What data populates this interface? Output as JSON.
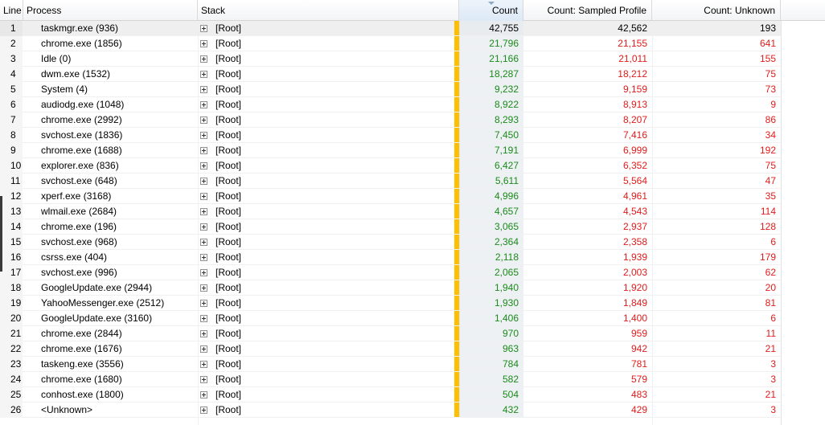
{
  "columns": {
    "line": "Line",
    "process": "Process",
    "stack": "Stack",
    "count": "Count",
    "sampled": "Count: Sampled Profile",
    "unknown": "Count: Unknown"
  },
  "colors": {
    "bar": "#ffbf00",
    "positive": "#1b8a1b",
    "negative": "#e01b1b"
  },
  "rows": [
    {
      "line": "1",
      "process": "taskmgr.exe (936)",
      "stack": "[Root]",
      "count": "42,755",
      "sampled": "42,562",
      "unknown": "193"
    },
    {
      "line": "2",
      "process": "chrome.exe (1856)",
      "stack": "[Root]",
      "count": "21,796",
      "sampled": "21,155",
      "unknown": "641"
    },
    {
      "line": "3",
      "process": "Idle (0)",
      "stack": "[Root]",
      "count": "21,166",
      "sampled": "21,011",
      "unknown": "155"
    },
    {
      "line": "4",
      "process": "dwm.exe (1532)",
      "stack": "[Root]",
      "count": "18,287",
      "sampled": "18,212",
      "unknown": "75"
    },
    {
      "line": "5",
      "process": "System (4)",
      "stack": "[Root]",
      "count": "9,232",
      "sampled": "9,159",
      "unknown": "73"
    },
    {
      "line": "6",
      "process": "audiodg.exe (1048)",
      "stack": "[Root]",
      "count": "8,922",
      "sampled": "8,913",
      "unknown": "9"
    },
    {
      "line": "7",
      "process": "chrome.exe (2992)",
      "stack": "[Root]",
      "count": "8,293",
      "sampled": "8,207",
      "unknown": "86"
    },
    {
      "line": "8",
      "process": "svchost.exe (1836)",
      "stack": "[Root]",
      "count": "7,450",
      "sampled": "7,416",
      "unknown": "34"
    },
    {
      "line": "9",
      "process": "chrome.exe (1688)",
      "stack": "[Root]",
      "count": "7,191",
      "sampled": "6,999",
      "unknown": "192"
    },
    {
      "line": "10",
      "process": "explorer.exe (836)",
      "stack": "[Root]",
      "count": "6,427",
      "sampled": "6,352",
      "unknown": "75"
    },
    {
      "line": "11",
      "process": "svchost.exe (648)",
      "stack": "[Root]",
      "count": "5,611",
      "sampled": "5,564",
      "unknown": "47"
    },
    {
      "line": "12",
      "process": "xperf.exe (3168)",
      "stack": "[Root]",
      "count": "4,996",
      "sampled": "4,961",
      "unknown": "35"
    },
    {
      "line": "13",
      "process": "wlmail.exe (2684)",
      "stack": "[Root]",
      "count": "4,657",
      "sampled": "4,543",
      "unknown": "114"
    },
    {
      "line": "14",
      "process": "chrome.exe (196)",
      "stack": "[Root]",
      "count": "3,065",
      "sampled": "2,937",
      "unknown": "128"
    },
    {
      "line": "15",
      "process": "svchost.exe (968)",
      "stack": "[Root]",
      "count": "2,364",
      "sampled": "2,358",
      "unknown": "6"
    },
    {
      "line": "16",
      "process": "csrss.exe (404)",
      "stack": "[Root]",
      "count": "2,118",
      "sampled": "1,939",
      "unknown": "179"
    },
    {
      "line": "17",
      "process": "svchost.exe (996)",
      "stack": "[Root]",
      "count": "2,065",
      "sampled": "2,003",
      "unknown": "62"
    },
    {
      "line": "18",
      "process": "GoogleUpdate.exe (2944)",
      "stack": "[Root]",
      "count": "1,940",
      "sampled": "1,920",
      "unknown": "20"
    },
    {
      "line": "19",
      "process": "YahooMessenger.exe (2512)",
      "stack": "[Root]",
      "count": "1,930",
      "sampled": "1,849",
      "unknown": "81"
    },
    {
      "line": "20",
      "process": "GoogleUpdate.exe (3160)",
      "stack": "[Root]",
      "count": "1,406",
      "sampled": "1,400",
      "unknown": "6"
    },
    {
      "line": "21",
      "process": "chrome.exe (2844)",
      "stack": "[Root]",
      "count": "970",
      "sampled": "959",
      "unknown": "11"
    },
    {
      "line": "22",
      "process": "chrome.exe (1676)",
      "stack": "[Root]",
      "count": "963",
      "sampled": "942",
      "unknown": "21"
    },
    {
      "line": "23",
      "process": "taskeng.exe (3556)",
      "stack": "[Root]",
      "count": "784",
      "sampled": "781",
      "unknown": "3"
    },
    {
      "line": "24",
      "process": "chrome.exe (1680)",
      "stack": "[Root]",
      "count": "582",
      "sampled": "579",
      "unknown": "3"
    },
    {
      "line": "25",
      "process": "conhost.exe (1800)",
      "stack": "[Root]",
      "count": "504",
      "sampled": "483",
      "unknown": "21"
    },
    {
      "line": "26",
      "process": "<Unknown>",
      "stack": "[Root]",
      "count": "432",
      "sampled": "429",
      "unknown": "3"
    }
  ]
}
